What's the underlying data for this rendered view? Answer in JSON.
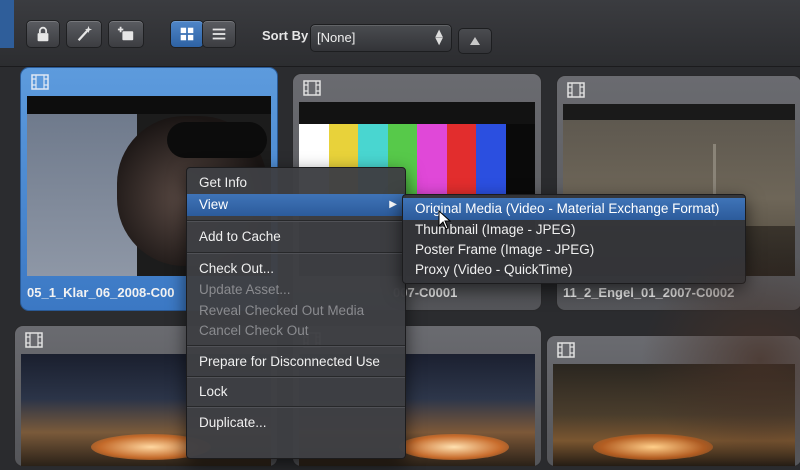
{
  "toolbar": {
    "sort_label": "Sort By",
    "sort_value": "[None]",
    "buttons": [
      "lock-icon",
      "magic-wand-icon",
      "add-to-folder-icon",
      "grid-view-icon",
      "list-view-icon"
    ],
    "accent": "#3f74b8"
  },
  "assets": [
    {
      "label": "05_1_Klar_06_2008-C00",
      "selected": true
    },
    {
      "label": "007-C0001",
      "selected": false
    },
    {
      "label": "11_2_Engel_01_2007-C0002",
      "selected": false
    },
    {
      "label": "",
      "selected": false
    },
    {
      "label": "",
      "selected": false
    },
    {
      "label": "",
      "selected": false
    }
  ],
  "context_menu": {
    "items": [
      {
        "label": "Get Info",
        "enabled": true
      },
      {
        "label": "View",
        "enabled": true,
        "submenu": true,
        "highlighted": true
      },
      {
        "label": "Add to Cache",
        "enabled": true
      },
      {
        "label": "Check Out...",
        "enabled": true
      },
      {
        "label": "Update Asset...",
        "enabled": false
      },
      {
        "label": "Reveal Checked Out Media",
        "enabled": false
      },
      {
        "label": "Cancel Check Out",
        "enabled": false
      },
      {
        "label": "Prepare for Disconnected Use",
        "enabled": true
      },
      {
        "label": "Lock",
        "enabled": true
      },
      {
        "label": "Duplicate...",
        "enabled": true
      }
    ]
  },
  "view_submenu": {
    "items": [
      {
        "label": "Original Media (Video - Material Exchange Format)",
        "highlighted": true
      },
      {
        "label": "Thumbnail (Image - JPEG)"
      },
      {
        "label": "Poster Frame (Image - JPEG)"
      },
      {
        "label": "Proxy (Video - QuickTime)"
      }
    ]
  },
  "color_bars": [
    "#ffffff",
    "#e8d23a",
    "#49d6d0",
    "#57c94a",
    "#e048d8",
    "#e22d2d",
    "#2b4fe0",
    "#0a0a0a"
  ]
}
